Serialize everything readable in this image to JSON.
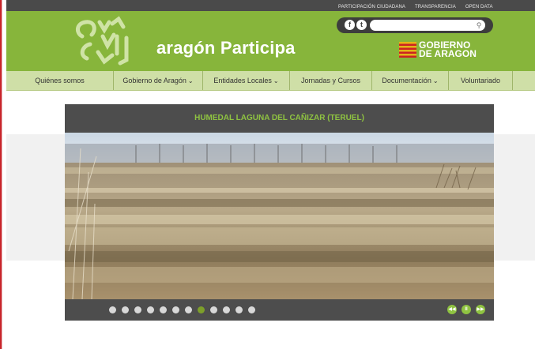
{
  "top_links": [
    "PARTICIPACIÓN CIUDADANA",
    "TRANSPARENCIA",
    "OPEN DATA"
  ],
  "brand": "aragón Participa",
  "gov_logo": {
    "line1": "GOBIERNO",
    "line2": "DE ARAGON"
  },
  "search": {
    "placeholder": ""
  },
  "social": {
    "facebook": "f",
    "twitter": "t"
  },
  "nav": {
    "items": [
      {
        "label": "Quiénes somos",
        "dropdown": false
      },
      {
        "label": "Gobierno de Aragón",
        "dropdown": true
      },
      {
        "label": "Entidades Locales",
        "dropdown": true
      },
      {
        "label": "Jornadas y Cursos",
        "dropdown": false
      },
      {
        "label": "Documentación",
        "dropdown": true
      },
      {
        "label": "Voluntariado",
        "dropdown": false
      }
    ]
  },
  "slider": {
    "title": "HUMEDAL LAGUNA DEL CAÑIZAR (TERUEL)",
    "slide_count": 12,
    "active_index": 7,
    "controls": {
      "prev": "◀◀",
      "pause": "II",
      "next": "▶▶"
    }
  },
  "colors": {
    "header_green": "#87b53b",
    "nav_green": "#cfdfa7",
    "title_green": "#8fc341",
    "slider_bg": "#4d4d4d"
  }
}
